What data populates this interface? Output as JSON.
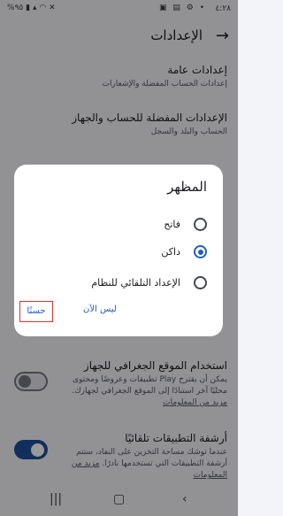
{
  "status": {
    "time": "٤:٢٨",
    "battery": "%٩٥"
  },
  "appbar": {
    "title": "الإعدادات"
  },
  "settings": [
    {
      "title": "إعدادات عامة",
      "subtitle": "إعدادات الحساب المفضلة والإشعارات"
    },
    {
      "title": "الإعدادات المفضلة للحساب والجهاز",
      "subtitle": "الحساب والبلد والسجل"
    }
  ],
  "location": {
    "title": "استخدام الموقع الجغرافي للجهاز",
    "subtitle": "يمكن أن يقترح Play تطبيقات وعروضًا ومحتوى محليًا آخر استنادًا إلى الموقع الجغرافي لجهازك.",
    "link": "مزيد من المعلومات",
    "toggle": "off"
  },
  "archive": {
    "title": "أرشفة التطبيقات تلقائيًا",
    "subtitle": "عندما توشك مساحة التخزين على النفاد، ستتم أرشفة التطبيقات التي تستخدمها نادرًا.",
    "link": "مزيد من المعلومات",
    "toggle": "on"
  },
  "dialog": {
    "title": "المظهر",
    "options": [
      {
        "label": "فاتح",
        "checked": false
      },
      {
        "label": "داكن",
        "checked": true
      },
      {
        "label": "الإعداد التلقائي للنظام",
        "checked": false
      }
    ],
    "ok_label": "حسنًا",
    "not_now_label": "ليس الآن"
  },
  "colors": {
    "accent": "#1f5fbf",
    "highlight": "#e0302b"
  }
}
